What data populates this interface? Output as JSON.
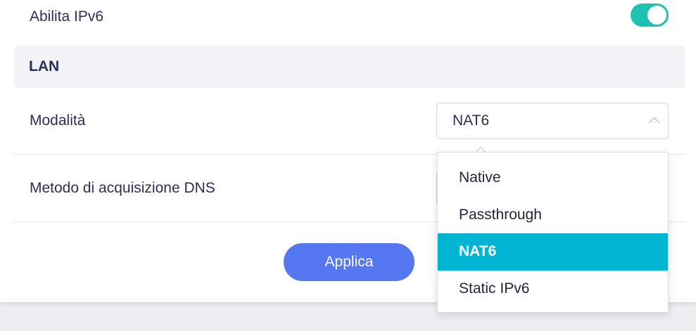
{
  "ipv6": {
    "label": "Abilita IPv6",
    "enabled": true,
    "toggle_color": "#1ec2b0"
  },
  "lan": {
    "title": "LAN",
    "mode": {
      "label": "Modalità",
      "selected": "NAT6",
      "options": [
        "Native",
        "Passthrough",
        "NAT6",
        "Static IPv6"
      ]
    },
    "dns": {
      "label": "Metodo di acquisizione DNS"
    }
  },
  "apply_label": "Applica",
  "colors": {
    "accent_button": "#5577f2",
    "selected_option": "#00b4d2"
  }
}
